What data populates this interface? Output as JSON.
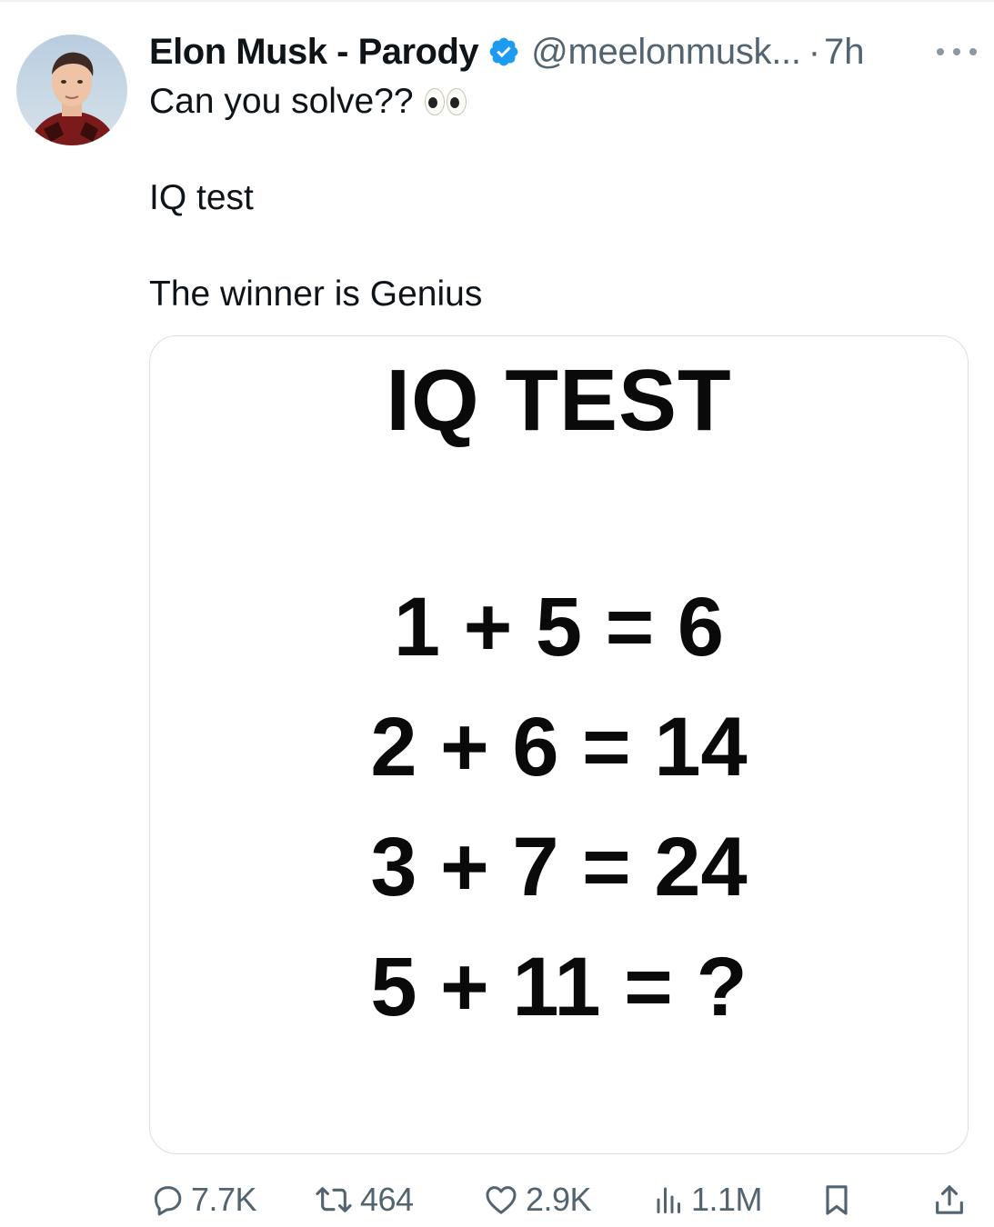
{
  "author": {
    "display_name": "Elon Musk - Parody",
    "handle": "@meelonmusk...",
    "separator": "·",
    "time_ago": "7h",
    "verified_color": "#1d9bf0"
  },
  "tweet": {
    "line1": "Can you solve??",
    "line2": "IQ test",
    "line3": "The winner is Genius"
  },
  "media": {
    "title": "IQ TEST",
    "equations": [
      "1 + 5 = 6",
      "2 + 6 = 14",
      "3 + 7 = 24",
      "5 + 11 = ?"
    ]
  },
  "actions": {
    "replies": "7.7K",
    "reposts": "464",
    "likes": "2.9K",
    "views": "1.1M"
  },
  "icons": [
    "more-icon",
    "verified-icon",
    "eyes-emoji",
    "reply-icon",
    "repost-icon",
    "like-icon",
    "views-icon",
    "bookmark-icon",
    "share-icon"
  ]
}
